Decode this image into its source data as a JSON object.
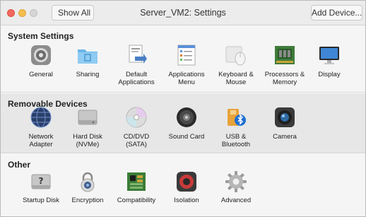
{
  "window": {
    "title": "Server_VM2: Settings",
    "show_all_label": "Show All",
    "add_device_label": "Add Device..."
  },
  "sections": [
    {
      "title": "System Settings",
      "items": [
        {
          "label": "General",
          "icon": "general-icon"
        },
        {
          "label": "Sharing",
          "icon": "folder-icon"
        },
        {
          "label": "Default\nApplications",
          "icon": "default-apps-icon"
        },
        {
          "label": "Applications\nMenu",
          "icon": "app-menu-icon"
        },
        {
          "label": "Keyboard &\nMouse",
          "icon": "keyboard-mouse-icon"
        },
        {
          "label": "Processors &\nMemory",
          "icon": "chip-icon"
        },
        {
          "label": "Display",
          "icon": "display-icon"
        }
      ]
    },
    {
      "title": "Removable Devices",
      "items": [
        {
          "label": "Network\nAdapter",
          "icon": "globe-icon"
        },
        {
          "label": "Hard Disk\n(NVMe)",
          "icon": "hard-disk-icon"
        },
        {
          "label": "CD/DVD\n(SATA)",
          "icon": "disc-icon"
        },
        {
          "label": "Sound Card",
          "icon": "speaker-icon"
        },
        {
          "label": "USB &\nBluetooth",
          "icon": "usb-bluetooth-icon"
        },
        {
          "label": "Camera",
          "icon": "camera-icon"
        }
      ]
    },
    {
      "title": "Other",
      "items": [
        {
          "label": "Startup Disk",
          "icon": "startup-disk-icon"
        },
        {
          "label": "Encryption",
          "icon": "lock-icon"
        },
        {
          "label": "Compatibility",
          "icon": "compatibility-icon"
        },
        {
          "label": "Isolation",
          "icon": "isolation-icon"
        },
        {
          "label": "Advanced",
          "icon": "gear-icon"
        }
      ]
    }
  ]
}
